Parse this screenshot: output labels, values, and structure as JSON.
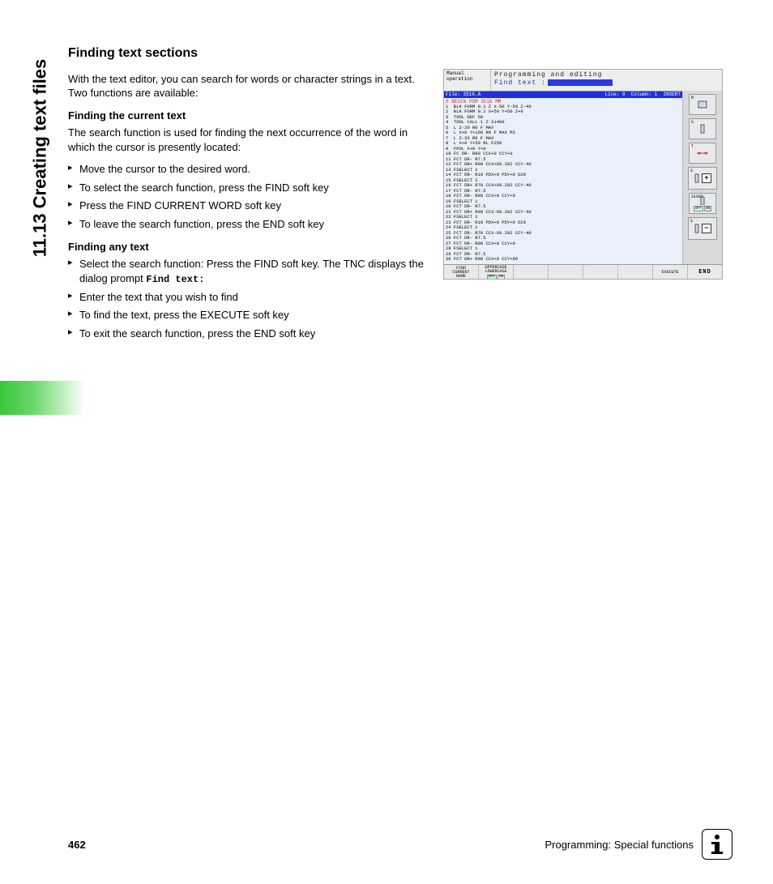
{
  "section_tab": "11.13 Creating text files",
  "heading": "Finding text sections",
  "intro": "With the text editor, you can search for words or character strings in a text. Two functions are available:",
  "sub1": "Finding the current text",
  "sub1_desc": "The search function is used for finding the next occurrence of the word in which the cursor is presently located:",
  "list1": [
    "Move the cursor to the desired word.",
    "To select the search function, press the FIND soft key",
    "Press the FIND CURRENT WORD soft key",
    "To leave the search function, press the END soft key"
  ],
  "sub2": "Finding any text",
  "list2": [
    {
      "text": "Select the search function: Press the FIND soft key. The TNC displays the dialog prompt ",
      "code": "Find text:"
    },
    {
      "text": "Enter the text that you wish to find"
    },
    {
      "text": "To find the text, press the EXECUTE soft key"
    },
    {
      "text": "To exit the search function, press the END soft key"
    }
  ],
  "screenshot": {
    "mode": "Manual\noperation",
    "title": "Programming and editing",
    "prompt": "Find text :",
    "status": {
      "file": "File: 3516.A",
      "line": "Line: 0",
      "column": "Column: 1",
      "mode": "INSERT"
    },
    "pgm_header": "0  BEGIN PGM 3516 MM",
    "listing": "1  BLK FORM 0.1 Z X-50 Y-50 Z-40\n2  BLK FORM 0.2 X+50 Y+50 Z+0\n3  TOOL DEF 50\n4  TOOL CALL 1 Z S1400\n5  L Z-20 R0 F MAX\n6  L X+0 Y+100 R0 F MAX M3\n7  L Z-20 R0 F MAX\n8  L X+0 Y+50 RL F250\n9  FPOL X+0 Y+0\n10 FC DR- R80 CCX+0 CCY+0\n11 FCT DR- R7.5\n12 FCT DR+ R90 CCX+69.282 CCY-40\n13 FSELECT 2\n14 FCT DR- R10 PDX+0 PDY+0 D20\n15 FSELECT 2\n16 FCT DR+ R70 CCX+69.282 CCY-40\n17 FCT DR- R7.5\n18 FCT DR- R80 CCX+0 CCY+0\n19 FSELECT 1\n20 FCT DR- R7.5\n21 FCT DR+ R90 CCX-69.282 CCY-40\n22 FSELECT 2\n23 FCT DR- R10 PDX+0 PDY+0 D20\n24 FSELECT 2\n25 FCT DR- R70 CCX-69.282 CCY-40\n26 FCT DR- R7.5\n27 FCT DR- R80 CCX+0 CCY+0\n28 FSELECT 1\n29 FCT DR- R7.5\n30 FCT DR+ R90 CCX+0 CCY+80",
    "sidebuttons": {
      "m": "M",
      "s": "S",
      "t": "T",
      "speed": "S",
      "s100": "S100%",
      "off": "OFF",
      "on": "ON",
      "splus": "S"
    },
    "softkeys": {
      "sk1a": "FIND",
      "sk1b": "CURRENT",
      "sk1c": "NAME",
      "sk2a": "UPPERCASE",
      "sk2b": "LOWERCASE",
      "sk2_off": "OFF",
      "sk2_on": "ON",
      "sk7": "EXECUTE",
      "sk8": "END"
    }
  },
  "footer": {
    "page": "462",
    "chapter": "Programming: Special functions"
  }
}
